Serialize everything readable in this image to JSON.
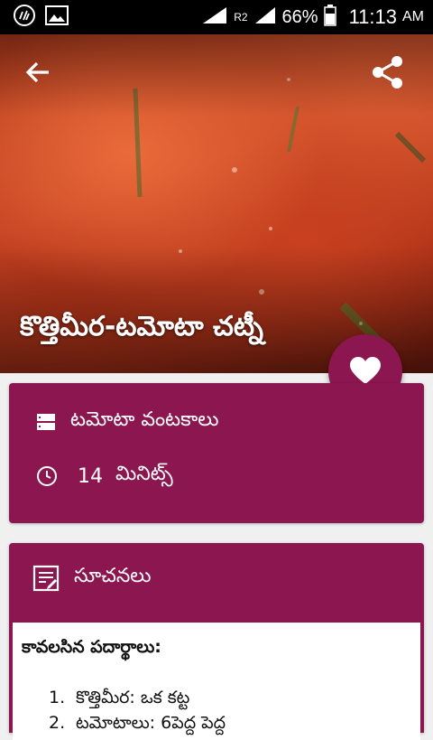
{
  "status_bar": {
    "battery_text": "66%",
    "time": "11:13",
    "ampm": "AM",
    "signal_label": "R2",
    "icons": [
      "whatsapp-icon",
      "gallery-icon",
      "signal-icon",
      "battery-icon"
    ]
  },
  "hero": {
    "title": "కొత్తిమీర-టమోటా చట్నీ",
    "icons": [
      "back-arrow-icon",
      "share-icon"
    ]
  },
  "fab": {
    "icon": "heart-icon",
    "color": "#8c1650"
  },
  "info_card": {
    "category": "టమోటా వంటకాలు",
    "time_value": "14",
    "time_unit": "మినిట్స్",
    "icons": [
      "category-icon",
      "clock-icon"
    ]
  },
  "instructions_card": {
    "title": "సూచనలు",
    "icon": "notes-edit-icon",
    "ingredients_heading": "కావలసిన పదార్థాలు:",
    "ingredients": [
      {
        "num": "1.",
        "text": "కొత్తిమీర: ఒక కట్ట"
      },
      {
        "num": "2.",
        "text": "టమోటాలు: 6పెద్ద పెద్ద"
      }
    ]
  },
  "colors": {
    "accent": "#8c1650",
    "status_bar": "#000000",
    "background": "#f0f0f0"
  }
}
